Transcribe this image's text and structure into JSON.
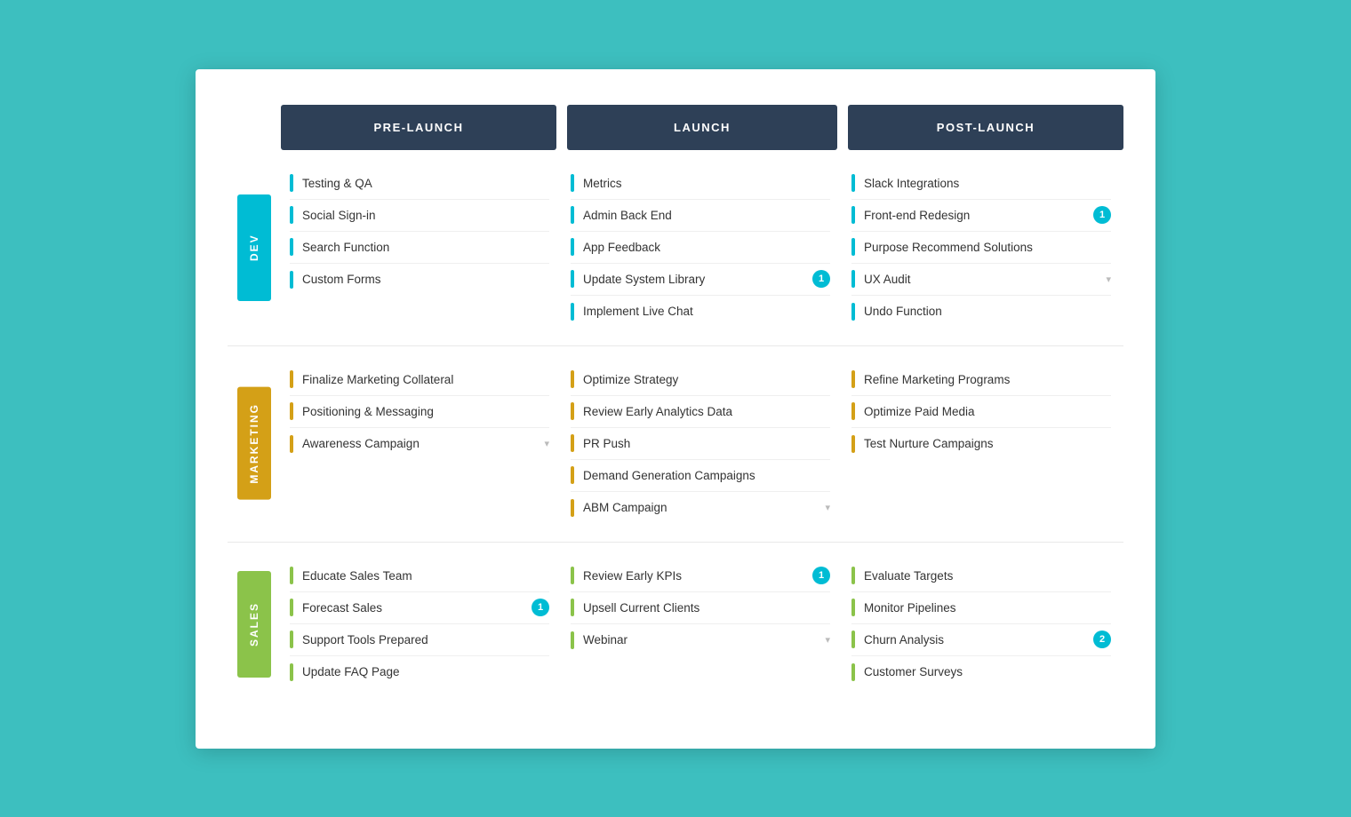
{
  "columns": {
    "prelaunch": "PRE-LAUNCH",
    "launch": "LAUNCH",
    "postlaunch": "POST-LAUNCH"
  },
  "rows": {
    "dev": {
      "label": "DEV",
      "color": "dev",
      "prelaunch": [
        {
          "text": "Testing & QA",
          "badge": null,
          "arrow": false
        },
        {
          "text": "Social Sign-in",
          "badge": null,
          "arrow": false
        },
        {
          "text": "Search Function",
          "badge": null,
          "arrow": false
        },
        {
          "text": "Custom Forms",
          "badge": null,
          "arrow": false
        }
      ],
      "launch": [
        {
          "text": "Metrics",
          "badge": null,
          "arrow": false
        },
        {
          "text": "Admin Back End",
          "badge": null,
          "arrow": false
        },
        {
          "text": "App Feedback",
          "badge": null,
          "arrow": false
        },
        {
          "text": "Update System Library",
          "badge": "1",
          "arrow": false
        },
        {
          "text": "Implement Live Chat",
          "badge": null,
          "arrow": false
        }
      ],
      "postlaunch": [
        {
          "text": "Slack Integrations",
          "badge": null,
          "arrow": false
        },
        {
          "text": "Front-end Redesign",
          "badge": "1",
          "arrow": false
        },
        {
          "text": "Purpose Recommend Solutions",
          "badge": null,
          "arrow": false
        },
        {
          "text": "UX Audit",
          "badge": null,
          "arrow": true
        },
        {
          "text": "Undo Function",
          "badge": null,
          "arrow": false
        }
      ]
    },
    "marketing": {
      "label": "MARKETING",
      "color": "marketing",
      "prelaunch": [
        {
          "text": "Finalize Marketing Collateral",
          "badge": null,
          "arrow": false
        },
        {
          "text": "Positioning & Messaging",
          "badge": null,
          "arrow": false
        },
        {
          "text": "Awareness Campaign",
          "badge": null,
          "arrow": true
        }
      ],
      "launch": [
        {
          "text": "Optimize Strategy",
          "badge": null,
          "arrow": false
        },
        {
          "text": "Review Early Analytics Data",
          "badge": null,
          "arrow": false
        },
        {
          "text": "PR Push",
          "badge": null,
          "arrow": false
        },
        {
          "text": "Demand Generation Campaigns",
          "badge": null,
          "arrow": false
        },
        {
          "text": "ABM Campaign",
          "badge": null,
          "arrow": true
        }
      ],
      "postlaunch": [
        {
          "text": "Refine Marketing Programs",
          "badge": null,
          "arrow": false
        },
        {
          "text": "Optimize Paid Media",
          "badge": null,
          "arrow": false
        },
        {
          "text": "Test Nurture Campaigns",
          "badge": null,
          "arrow": false
        }
      ]
    },
    "sales": {
      "label": "SALES",
      "color": "sales",
      "prelaunch": [
        {
          "text": "Educate Sales Team",
          "badge": null,
          "arrow": false
        },
        {
          "text": "Forecast Sales",
          "badge": "1",
          "arrow": false
        },
        {
          "text": "Support Tools Prepared",
          "badge": null,
          "arrow": false
        },
        {
          "text": "Update FAQ Page",
          "badge": null,
          "arrow": false
        }
      ],
      "launch": [
        {
          "text": "Review Early KPIs",
          "badge": "1",
          "arrow": false
        },
        {
          "text": "Upsell Current Clients",
          "badge": null,
          "arrow": false
        },
        {
          "text": "Webinar",
          "badge": null,
          "arrow": true
        }
      ],
      "postlaunch": [
        {
          "text": "Evaluate Targets",
          "badge": null,
          "arrow": false
        },
        {
          "text": "Monitor Pipelines",
          "badge": null,
          "arrow": false
        },
        {
          "text": "Churn Analysis",
          "badge": "2",
          "arrow": false
        },
        {
          "text": "Customer Surveys",
          "badge": null,
          "arrow": false
        }
      ]
    }
  }
}
